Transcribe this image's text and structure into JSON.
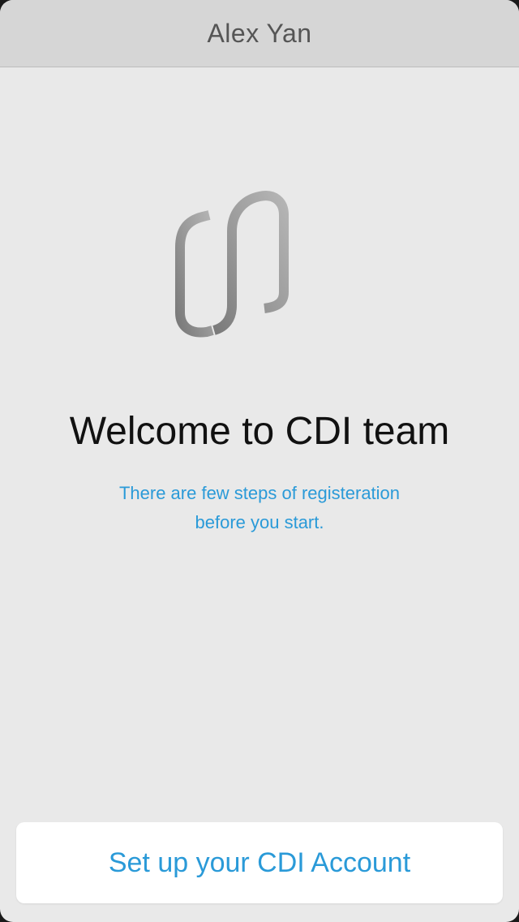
{
  "nav": {
    "title": "Alex Yan"
  },
  "logo": {
    "icon": "cdi-logo-icon"
  },
  "main": {
    "welcome": "Welcome to CDI team",
    "subtitle_line1": "There are few steps of registeration",
    "subtitle_line2": "before you start."
  },
  "action": {
    "setup_label": "Set up your CDI Account"
  },
  "colors": {
    "background": "#e9e9e9",
    "nav_background": "#d6d6d6",
    "accent": "#2a9ad8",
    "button_background": "#ffffff"
  }
}
